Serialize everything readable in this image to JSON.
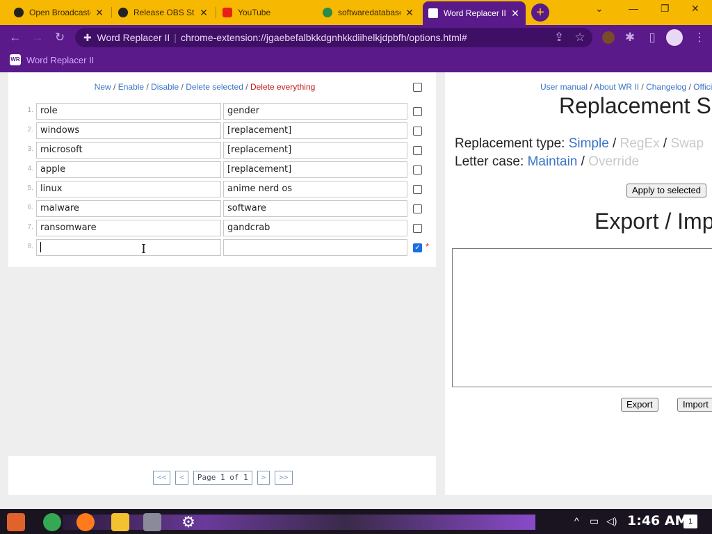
{
  "browser": {
    "tabs": [
      {
        "title": "Open Broadcaster",
        "icon": "obs-icon"
      },
      {
        "title": "Release OBS Studio",
        "icon": "github-icon"
      },
      {
        "title": "YouTube",
        "icon": "youtube-icon"
      },
      {
        "title": "softwaredatabase",
        "icon": "page-icon"
      },
      {
        "title": "Word Replacer II",
        "icon": "wr-icon",
        "active": true
      }
    ],
    "new_tab_label": "+",
    "omnibox": {
      "site_label": "Word Replacer II",
      "url": "chrome-extension://jgaebefalbkkdgnhkkdiihelkjdpbfh/options.html#"
    },
    "bookmark": "Word Replacer II"
  },
  "rules_panel": {
    "actions": {
      "new": "New",
      "enable": "Enable",
      "disable": "Disable",
      "delete_selected": "Delete selected",
      "delete_everything": "Delete everything",
      "separator": "/"
    },
    "rules": [
      {
        "num": "1.",
        "find": "role",
        "replace": "gender",
        "checked": false
      },
      {
        "num": "2.",
        "find": "windows",
        "replace": "[replacement]",
        "checked": false
      },
      {
        "num": "3.",
        "find": "microsoft",
        "replace": "[replacement]",
        "checked": false
      },
      {
        "num": "4.",
        "find": "apple",
        "replace": "[replacement]",
        "checked": false
      },
      {
        "num": "5.",
        "find": "linux",
        "replace": "anime nerd os",
        "checked": false
      },
      {
        "num": "6.",
        "find": "malware",
        "replace": "software",
        "checked": false
      },
      {
        "num": "7.",
        "find": "ransomware",
        "replace": "gandcrab",
        "checked": false
      },
      {
        "num": "8.",
        "find": "",
        "replace": "",
        "checked": true,
        "unsaved_marker": "*"
      }
    ],
    "pager": {
      "first": "<<",
      "prev": "<",
      "page_label": "Page 1 of 1",
      "next": ">",
      "last": ">>"
    }
  },
  "options_panel": {
    "links": [
      "User manual",
      "About WR II",
      "Changelog",
      "Offici"
    ],
    "title": "Replacement S",
    "replacement_type": {
      "label": "Replacement type:",
      "options": [
        "Simple",
        "RegEx",
        "Swap"
      ],
      "selected": "Simple"
    },
    "letter_case": {
      "label": "Letter case:",
      "options": [
        "Maintain",
        "Override"
      ],
      "selected": "Maintain"
    },
    "apply_button": "Apply to selected",
    "export_import_title": "Export / Imp",
    "export_button": "Export",
    "import_button": "Import"
  },
  "taskbar": {
    "clock": "1:46 AM",
    "notification_count": "1"
  }
}
